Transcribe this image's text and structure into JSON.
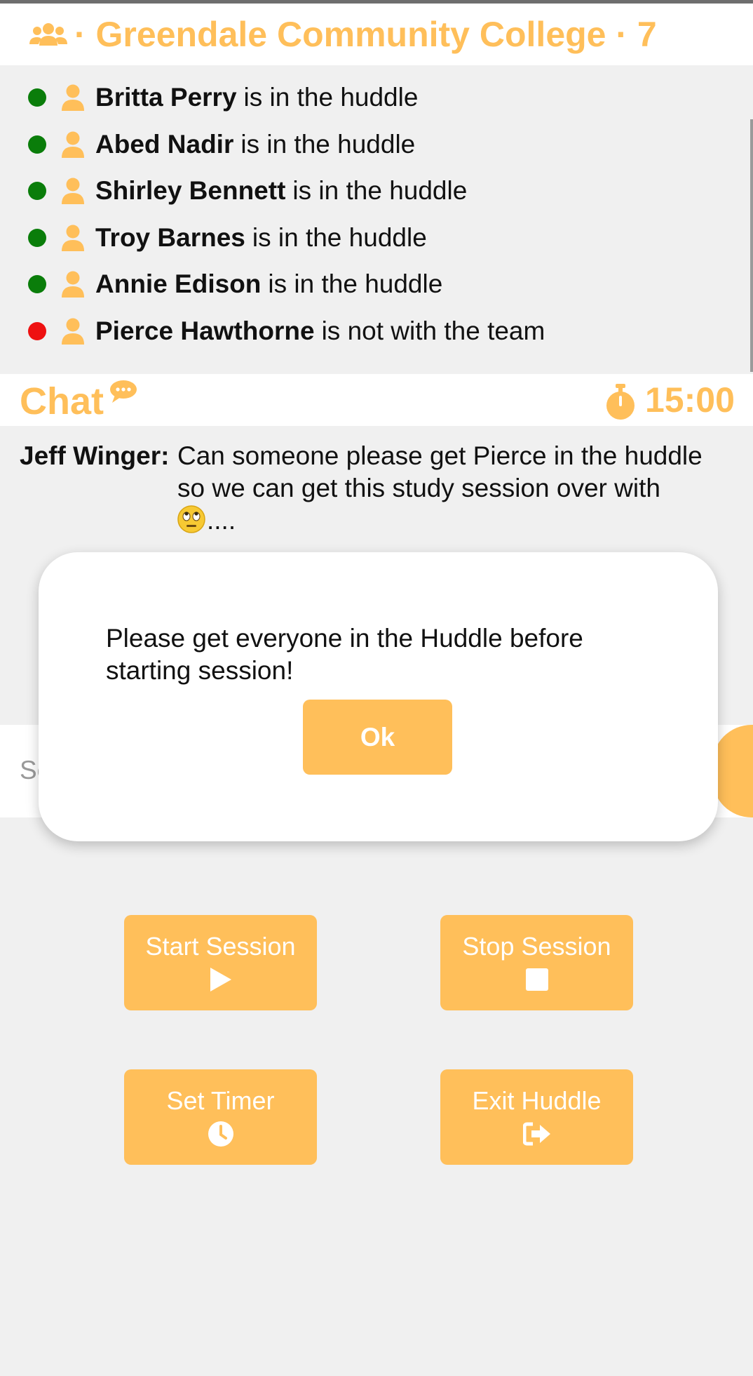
{
  "header": {
    "title": "· Greendale Community College · 7",
    "icon": "users-icon"
  },
  "members": [
    {
      "name": "Britta Perry",
      "status_text": "is in the huddle",
      "status": "in"
    },
    {
      "name": "Abed Nadir",
      "status_text": "is in the huddle",
      "status": "in"
    },
    {
      "name": "Shirley Bennett",
      "status_text": "is in the huddle",
      "status": "in"
    },
    {
      "name": "Troy Barnes",
      "status_text": "is in the huddle",
      "status": "in"
    },
    {
      "name": "Annie Edison",
      "status_text": "is in the huddle",
      "status": "in"
    },
    {
      "name": "Pierce Hawthorne",
      "status_text": "is not with the team",
      "status": "out"
    }
  ],
  "chat": {
    "title": "Chat",
    "timer": "15:00",
    "messages": [
      {
        "sender": "Jeff Winger:",
        "text": "Can someone please get Pierce in the huddle so we can get this study session over with",
        "suffix": "...."
      }
    ],
    "composer_placeholder": "Se"
  },
  "modal": {
    "message": "Please get everyone in the Huddle before starting session!",
    "ok_label": "Ok"
  },
  "actions": {
    "start_label": "Start Session",
    "stop_label": "Stop Session",
    "timer_label": "Set Timer",
    "exit_label": "Exit Huddle"
  },
  "colors": {
    "accent": "#ffbf5a",
    "in_huddle": "#0a7d0a",
    "not_in_huddle": "#ee1111",
    "background": "#f0f0f0"
  }
}
